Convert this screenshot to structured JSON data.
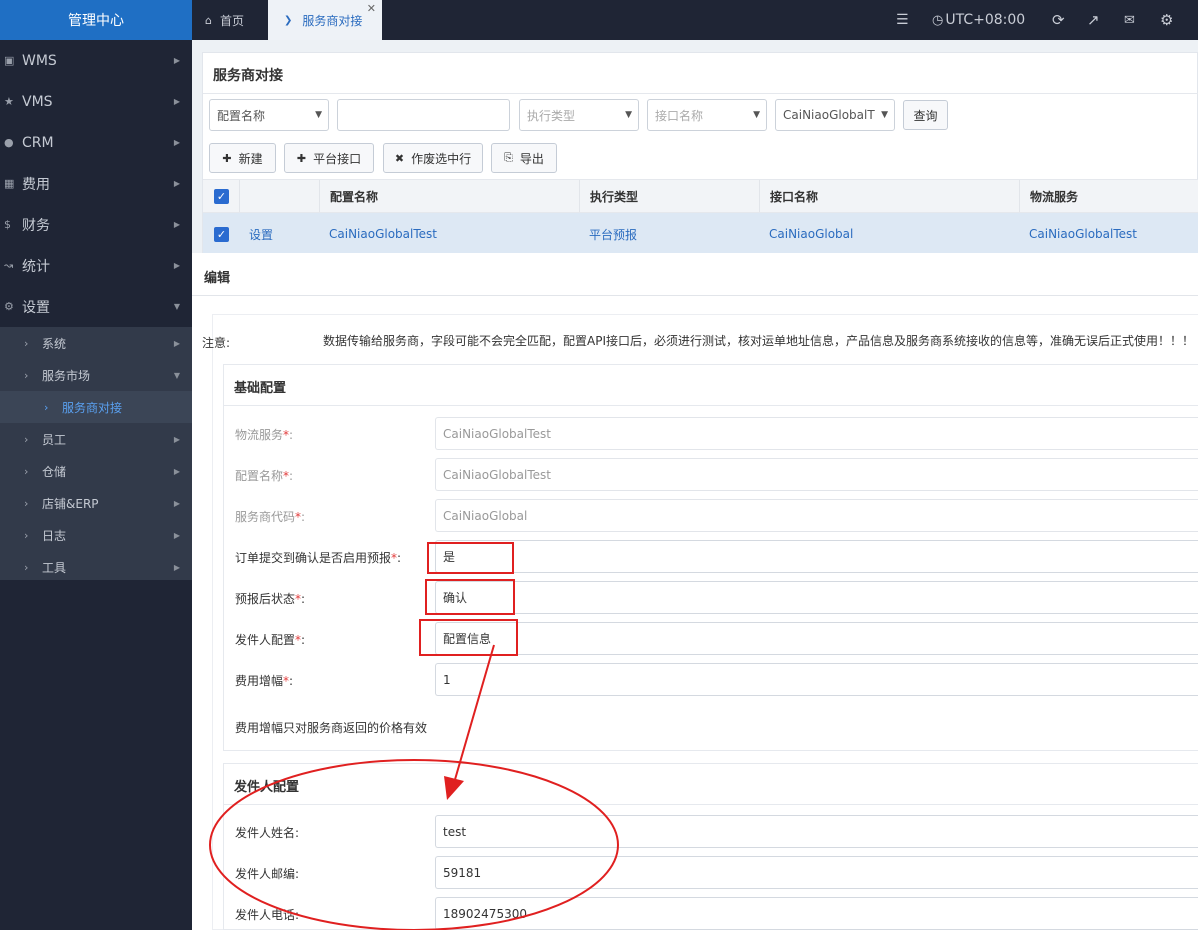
{
  "brand": "管理中心",
  "tabs": {
    "home": "首页",
    "active": "服务商对接"
  },
  "topbar": {
    "timezone": "UTC+08:00"
  },
  "sidebar": {
    "top_items": [
      {
        "label": "WMS",
        "icon": "bank-icon"
      },
      {
        "label": "VMS",
        "icon": "star-icon"
      },
      {
        "label": "CRM",
        "icon": "user-circle-icon"
      },
      {
        "label": "费用",
        "icon": "table-icon"
      },
      {
        "label": "财务",
        "icon": "dollar-icon"
      },
      {
        "label": "统计",
        "icon": "line-chart-icon"
      },
      {
        "label": "设置",
        "icon": "gear-icon"
      }
    ],
    "sub_items": [
      {
        "label": "系统"
      },
      {
        "label": "服务市场"
      },
      {
        "label": "服务商对接"
      },
      {
        "label": "员工"
      },
      {
        "label": "仓储"
      },
      {
        "label": "店铺&ERP"
      },
      {
        "label": "日志"
      },
      {
        "label": "工具"
      }
    ]
  },
  "page": {
    "title": "服务商对接",
    "filters": {
      "config_name_select": "配置名称",
      "config_name_input": "",
      "exec_type_placeholder": "执行类型",
      "api_name_placeholder": "接口名称",
      "service_select": "CaiNiaoGlobalT",
      "query_button": "查询"
    },
    "toolbar": {
      "new": "新建",
      "platform_api": "平台接口",
      "void_selected": "作废选中行",
      "export": "导出"
    },
    "grid": {
      "columns": [
        "配置名称",
        "执行类型",
        "接口名称",
        "物流服务"
      ],
      "rows": [
        {
          "action": "设置",
          "config_name": "CaiNiaoGlobalTest",
          "exec_type": "平台预报",
          "api_name": "CaiNiaoGlobal",
          "service": "CaiNiaoGlobalTest"
        }
      ]
    }
  },
  "dialog": {
    "title": "编辑",
    "notice_label": "注意:",
    "notice_text": "数据传输给服务商，字段可能不会完全匹配，配置API接口后，必须进行测试，核对运单地址信息，产品信息及服务商系统接收的信息等，准确无误后正式使用！！！",
    "basic": {
      "title": "基础配置",
      "fields": [
        {
          "label": "物流服务",
          "value": "CaiNiaoGlobalTest"
        },
        {
          "label": "配置名称",
          "value": "CaiNiaoGlobalTest"
        },
        {
          "label": "服务商代码",
          "value": "CaiNiaoGlobal"
        },
        {
          "label": "订单提交到确认是否启用预报",
          "value": "是"
        },
        {
          "label": "预报后状态",
          "value": "确认"
        },
        {
          "label": "发件人配置",
          "value": "配置信息"
        },
        {
          "label": "费用增幅",
          "value": "1"
        }
      ],
      "fee_note": "费用增幅只对服务商返回的价格有效"
    },
    "sender": {
      "title": "发件人配置",
      "fields": [
        {
          "label": "发件人姓名:",
          "value": "test"
        },
        {
          "label": "发件人邮编:",
          "value": "59181"
        },
        {
          "label": "发件人电话:",
          "value": "18902475300"
        }
      ]
    }
  },
  "colors": {
    "accent": "#1f6fc4",
    "sidebar": "#1f2535",
    "link": "#2a6bbf",
    "annotation": "#e02020"
  }
}
